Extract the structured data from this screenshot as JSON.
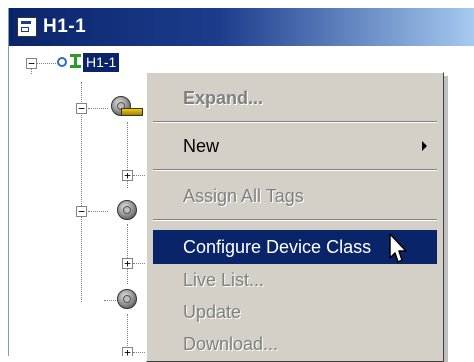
{
  "window": {
    "title": "H1-1"
  },
  "tree": {
    "root_label": "H1-1"
  },
  "context_menu": {
    "items": [
      {
        "label": "Expand...",
        "enabled": false,
        "bold": true
      },
      {
        "label": "New",
        "enabled": true,
        "submenu": true
      },
      {
        "label": "Assign All Tags",
        "enabled": false
      },
      {
        "label": "Configure Device Class",
        "enabled": true,
        "highlighted": true
      },
      {
        "label": "Live List...",
        "enabled": false
      },
      {
        "label": "Update",
        "enabled": false
      },
      {
        "label": "Download...",
        "enabled": false
      }
    ]
  },
  "colors": {
    "selection": "#0a246a",
    "menu_bg": "#d4d0c8",
    "disabled_text": "#808080"
  },
  "icons": [
    "document-icon",
    "network-icon",
    "device-icon",
    "expand-plus-icon",
    "collapse-minus-icon",
    "submenu-arrow-icon",
    "mouse-pointer-icon"
  ]
}
